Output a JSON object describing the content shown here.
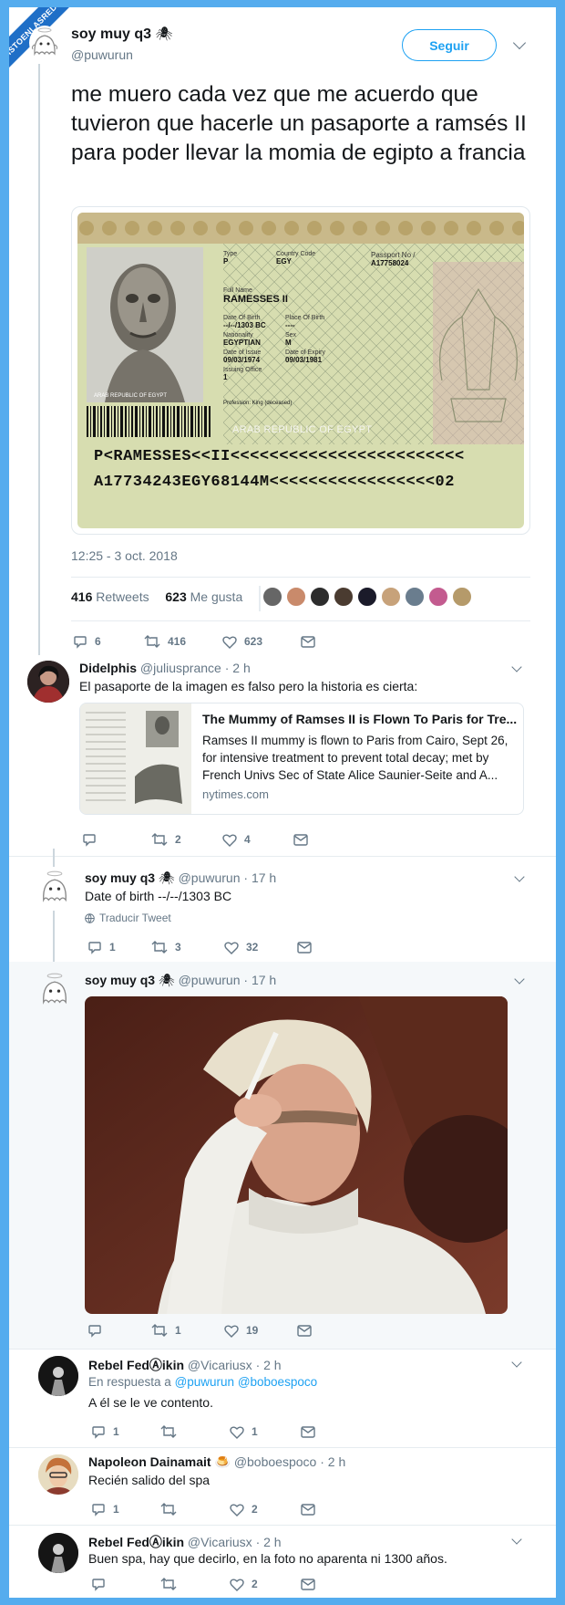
{
  "watermark": {
    "text": "VISTOENLASREDES",
    "sub": ".com"
  },
  "main_tweet": {
    "display_name": "soy muy q3",
    "handle": "@puwurun",
    "follow_label": "Seguir",
    "text": "me muero cada vez que me acuerdo que tuvieron que hacerle un pasaporte a ramsés II para poder llevar la momia de egipto a francia",
    "timestamp": "12:25 - 3 oct. 2018",
    "retweets_count": "416",
    "retweets_label": "Retweets",
    "likes_count": "623",
    "likes_label": "Me gusta",
    "actions": {
      "reply": "6",
      "retweet": "416",
      "like": "623"
    }
  },
  "passport": {
    "type_label": "Type",
    "type_value": "P",
    "country_label": "Country Code",
    "country_value": "EGY",
    "passport_no_label": "Passport No /",
    "passport_no_value": "A17758024",
    "full_name_label": "Full Name",
    "full_name_value": "RAMESSES II",
    "dob_label": "Date Of Birth",
    "dob_value": "--/--/1303 BC",
    "pob_label": "Place Of Birth",
    "pob_value": "----",
    "nationality_label": "Nationality",
    "nationality_value": "EGYPTIAN",
    "sex_label": "Sex",
    "sex_value": "M",
    "issue_label": "Date of Issue",
    "issue_value": "09/03/1974",
    "expiry_label": "Date of Expiry",
    "expiry_value": "09/03/1981",
    "office_label": "Issuing Office",
    "office_value": "1",
    "profession": "Profession: King (deceased)",
    "photo_caption": "ARAB REPUBLIC OF EGYPT",
    "country_banner": "ARAB REPUBLIC OF EGYPT",
    "mrz_line1": "P<RAMESSES<<II<<<<<<<<<<<<<<<<<<<<<<<<",
    "mrz_line2": "A17734243EGY68144M<<<<<<<<<<<<<<<<<02"
  },
  "reply1": {
    "display_name": "Didelphis",
    "handle": "@juliusprance",
    "time": "· 2 h",
    "text": "El pasaporte de la imagen es falso pero la historia es cierta:",
    "card": {
      "title": "The Mummy of Ramses II is Flown To Paris for Tre...",
      "description": "Ramses II mummy is flown to Paris from Cairo, Sept 26, for intensive treatment to prevent total decay; met by French Univs Sec of State Alice Saunier-Seite and A...",
      "domain": "nytimes.com"
    },
    "actions": {
      "reply": "",
      "retweet": "2",
      "like": "4"
    }
  },
  "reply2": {
    "display_name": "soy muy q3",
    "handle": "@puwurun",
    "time": "· 17 h",
    "text": "Date of birth --/--/1303 BC",
    "translate": "Traducir Tweet",
    "actions": {
      "reply": "1",
      "retweet": "3",
      "like": "32"
    }
  },
  "reply3": {
    "display_name": "soy muy q3",
    "handle": "@puwurun",
    "time": "· 17 h",
    "actions": {
      "reply": "",
      "retweet": "1",
      "like": "19"
    }
  },
  "reply4": {
    "display_name": "Rebel FedⒶikin",
    "handle": "@Vicariusx",
    "time": "· 2 h",
    "in_reply_prefix": "En respuesta a",
    "in_reply_users": "@puwurun @boboespoco",
    "text": "A él se le ve contento.",
    "actions": {
      "reply": "1",
      "retweet": "",
      "like": "1"
    }
  },
  "reply5": {
    "display_name": "Napoleon Dainamait",
    "emoji": "🍮",
    "handle": "@boboespoco",
    "time": "· 2 h",
    "text": "Recién salido del spa",
    "actions": {
      "reply": "1",
      "retweet": "",
      "like": "2"
    }
  },
  "reply6": {
    "display_name": "Rebel FedⒶikin",
    "handle": "@Vicariusx",
    "time": "· 2 h",
    "text": "Buen spa, hay que decirlo, en la foto no aparenta ni 1300 años.",
    "actions": {
      "reply": "",
      "retweet": "",
      "like": "2"
    }
  },
  "colors": {
    "accent": "#1da1f2",
    "frame": "#55acee",
    "muted": "#657786",
    "passport_green": "#d7ddb0"
  }
}
